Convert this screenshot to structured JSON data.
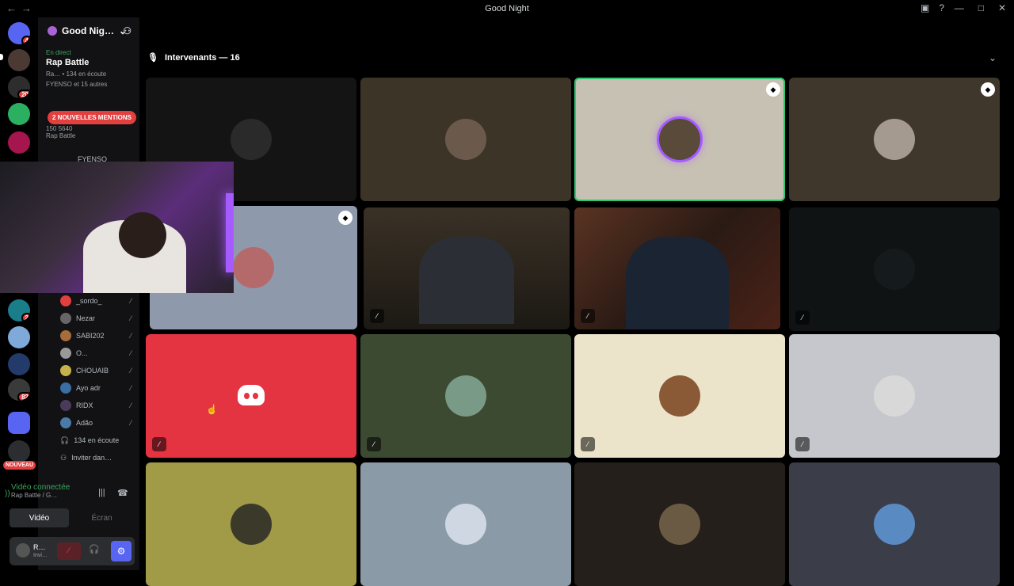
{
  "window": {
    "title": "Good Night"
  },
  "server": {
    "name": "Good Nig…"
  },
  "live": {
    "status": "En direct",
    "event": "Rap Battle",
    "meta": "Ra… • 134 en écoute",
    "attendees": "FYENSO et 15 autres"
  },
  "mentions": {
    "label": "2 NOUVELLES MENTIONS"
  },
  "stage_channel": {
    "count1": "150",
    "count2": "5640",
    "name": "Rap Battle",
    "speaker": "FYENSO"
  },
  "server_badges": {
    "home": "4",
    "s2": "20",
    "s3": "2",
    "s4": "82",
    "new": "NOUVEAU"
  },
  "members": [
    {
      "name": "_sordo_"
    },
    {
      "name": "Nezar"
    },
    {
      "name": "SABI202"
    },
    {
      "name": "O..."
    },
    {
      "name": "CHOUAIB"
    },
    {
      "name": "Ayo adr"
    },
    {
      "name": "RIDX"
    },
    {
      "name": "Adão"
    }
  ],
  "listeners": "134 en écoute",
  "invite": "Inviter dan…",
  "voice": {
    "status": "Vidéo connectée",
    "channel": "Rap Battle / G…",
    "video_btn": "Vidéo",
    "screen_btn": "Écran"
  },
  "user": {
    "name": "R…",
    "sub": "Invi…"
  },
  "stage": {
    "speakers_label": "Intervenants — 16"
  },
  "colors": {
    "speaking": "#2dc770",
    "discord_red": "#e53441",
    "accent": "#5865f2"
  }
}
